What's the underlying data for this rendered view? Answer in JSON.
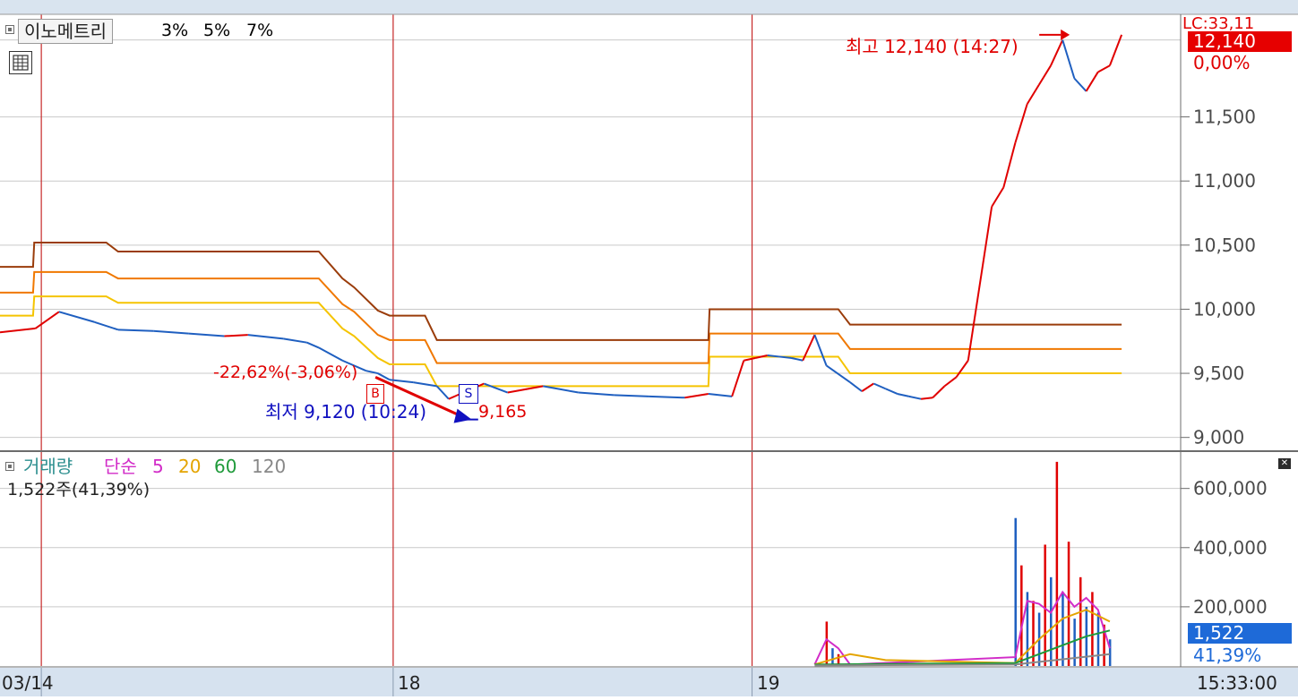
{
  "title": "이노메트리",
  "envelope_labels": [
    "3%",
    "5%",
    "7%"
  ],
  "indicator": {
    "name": "거래량",
    "ma_type": "단순",
    "ma_periods": [
      "5",
      "20",
      "60",
      "120"
    ],
    "current": "1,522주(41,39%)"
  },
  "annotations": {
    "high": "최고 12,140 (14:27)",
    "low": "최저 9,120 (10:24)",
    "trade_return": "-22,62%(-3,06%)",
    "sell_price": "9,165",
    "buy_marker": "B",
    "sell_marker": "S"
  },
  "current_price_tag": "12,140",
  "current_change_tag": "0,00%",
  "corner_text": "LC:33,11",
  "volume_tag": "1,522",
  "volume_pct_tag": "41,39%",
  "time_label": "15:33:00",
  "colors": {
    "up": "#e00000",
    "down": "#1f5fc0",
    "env3": "#f5c400",
    "env5": "#f07800",
    "env7": "#9a3c0a",
    "ma5": "#d22cc8",
    "ma20": "#e4a400",
    "ma60": "#1f9a3a",
    "ma120": "#888888",
    "axis_text": "#4a4a4a",
    "tag_bg": "#e60000",
    "vol_tag_bg": "#1e6ad8"
  },
  "chart_data": [
    {
      "type": "line",
      "title": "이노메트리",
      "x_type": "time",
      "categories": [
        "03/14",
        "18",
        "19"
      ],
      "ylim": [
        8900,
        12300
      ],
      "yticks": [
        "11,500",
        "11,000",
        "10,500",
        "10,000",
        "9,500",
        "9,000"
      ],
      "grid": true,
      "series": [
        {
          "name": "price",
          "x": [
            0.0,
            0.03,
            0.05,
            0.08,
            0.1,
            0.13,
            0.16,
            0.19,
            0.21,
            0.24,
            0.26,
            0.27,
            0.29,
            0.31,
            0.32,
            0.33,
            0.35,
            0.37,
            0.38,
            0.4,
            0.41,
            0.43,
            0.46,
            0.49,
            0.52,
            0.55,
            0.58,
            0.6,
            0.62,
            0.63,
            0.64,
            0.65,
            0.66,
            0.67,
            0.68,
            0.69,
            0.7,
            0.72,
            0.73,
            0.74,
            0.75,
            0.76,
            0.77,
            0.78,
            0.79,
            0.8,
            0.81,
            0.82,
            0.84,
            0.85,
            0.86,
            0.87,
            0.88,
            0.89,
            0.9,
            0.91,
            0.92,
            0.93,
            0.94,
            0.95
          ],
          "values": [
            9820,
            9850,
            9980,
            9900,
            9840,
            9830,
            9810,
            9790,
            9800,
            9770,
            9740,
            9700,
            9600,
            9520,
            9500,
            9450,
            9430,
            9400,
            9300,
            9380,
            9420,
            9350,
            9400,
            9350,
            9330,
            9320,
            9310,
            9340,
            9320,
            9600,
            9620,
            9640,
            9630,
            9620,
            9600,
            9800,
            9560,
            9430,
            9360,
            9420,
            9380,
            9340,
            9320,
            9300,
            9310,
            9400,
            9470,
            9600,
            10800,
            10950,
            11300,
            11600,
            11750,
            11900,
            12100,
            11800,
            11700,
            11850,
            11900,
            12140
          ]
        },
        {
          "name": "3%",
          "x": [
            0.0,
            0.028,
            0.029,
            0.09,
            0.1,
            0.27,
            0.29,
            0.3,
            0.32,
            0.33,
            0.36,
            0.37,
            0.6,
            0.601,
            0.71,
            0.72,
            0.95
          ],
          "values": [
            9950,
            9950,
            10100,
            10100,
            10050,
            10050,
            9850,
            9790,
            9620,
            9570,
            9570,
            9400,
            9400,
            9630,
            9630,
            9500,
            9500
          ]
        },
        {
          "name": "5%",
          "x": [
            0.0,
            0.028,
            0.029,
            0.09,
            0.1,
            0.27,
            0.29,
            0.3,
            0.32,
            0.33,
            0.36,
            0.37,
            0.6,
            0.601,
            0.71,
            0.72,
            0.95
          ],
          "values": [
            10130,
            10130,
            10290,
            10290,
            10240,
            10240,
            10040,
            9980,
            9800,
            9760,
            9760,
            9580,
            9580,
            9810,
            9810,
            9690,
            9690
          ]
        },
        {
          "name": "7%",
          "x": [
            0.0,
            0.028,
            0.029,
            0.09,
            0.1,
            0.27,
            0.29,
            0.3,
            0.32,
            0.33,
            0.36,
            0.37,
            0.6,
            0.601,
            0.71,
            0.72,
            0.95
          ],
          "values": [
            10330,
            10330,
            10520,
            10520,
            10450,
            10450,
            10240,
            10170,
            9990,
            9950,
            9950,
            9760,
            9760,
            10000,
            10000,
            9880,
            9880
          ]
        }
      ]
    },
    {
      "type": "bar",
      "title": "거래량",
      "ylim": [
        0,
        720000
      ],
      "yticks": [
        "600,000",
        "400,000",
        "200,000"
      ],
      "grid": true,
      "series": [
        {
          "name": "거래량",
          "x": [
            0.7,
            0.705,
            0.71,
            0.86,
            0.865,
            0.87,
            0.875,
            0.88,
            0.885,
            0.89,
            0.895,
            0.9,
            0.905,
            0.91,
            0.915,
            0.92,
            0.925,
            0.93,
            0.935,
            0.94
          ],
          "values": [
            150000,
            60000,
            40000,
            500000,
            340000,
            250000,
            220000,
            180000,
            410000,
            300000,
            690000,
            250000,
            420000,
            160000,
            300000,
            200000,
            250000,
            180000,
            140000,
            90000
          ]
        },
        {
          "name": "5",
          "x": [
            0.69,
            0.7,
            0.71,
            0.72,
            0.86,
            0.87,
            0.88,
            0.89,
            0.9,
            0.91,
            0.92,
            0.93,
            0.94
          ],
          "values": [
            5000,
            90000,
            60000,
            5000,
            30000,
            220000,
            210000,
            180000,
            250000,
            200000,
            230000,
            190000,
            60000
          ]
        },
        {
          "name": "20",
          "x": [
            0.69,
            0.72,
            0.75,
            0.86,
            0.88,
            0.9,
            0.92,
            0.94
          ],
          "values": [
            5000,
            40000,
            20000,
            10000,
            90000,
            160000,
            190000,
            150000
          ]
        },
        {
          "name": "60",
          "x": [
            0.69,
            0.86,
            0.88,
            0.9,
            0.92,
            0.94
          ],
          "values": [
            5000,
            10000,
            40000,
            70000,
            100000,
            120000
          ]
        },
        {
          "name": "120",
          "x": [
            0.69,
            0.86,
            0.94
          ],
          "values": [
            2000,
            5000,
            40000
          ]
        }
      ]
    }
  ]
}
